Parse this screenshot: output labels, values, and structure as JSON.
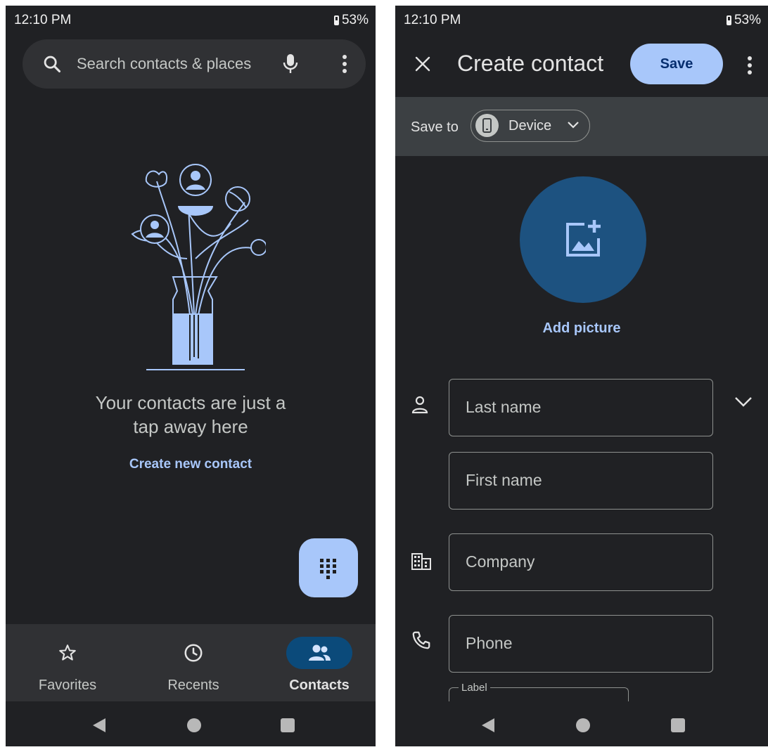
{
  "left": {
    "status": {
      "time": "12:10 PM",
      "battery": "53%"
    },
    "search": {
      "placeholder": "Search contacts & places"
    },
    "empty_state": {
      "line1": "Your contacts are just a",
      "line2": "tap away here",
      "link": "Create new contact"
    },
    "bottom_nav": {
      "favorites": "Favorites",
      "recents": "Recents",
      "contacts": "Contacts",
      "active": "Contacts"
    }
  },
  "right": {
    "status": {
      "time": "12:10 PM",
      "battery": "53%"
    },
    "header": {
      "title": "Create contact",
      "save": "Save"
    },
    "save_to": {
      "label": "Save to",
      "account": "Device"
    },
    "photo": {
      "label": "Add picture"
    },
    "fields": {
      "last_name": "Last name",
      "first_name": "First name",
      "company": "Company",
      "phone": "Phone",
      "label": "Label"
    }
  },
  "colors": {
    "background": "#202124",
    "surface": "#303134",
    "accent": "#a8c7fa",
    "avatar_bg": "#1d5280",
    "save_to_bar": "#3c4043"
  },
  "icons": [
    "search-icon",
    "mic-icon",
    "more-vert-icon",
    "dialpad-icon",
    "star-icon",
    "clock-icon",
    "people-icon",
    "close-icon",
    "phone-device-icon",
    "chevron-down-icon",
    "add-photo-icon",
    "person-icon",
    "business-icon",
    "phone-icon"
  ]
}
